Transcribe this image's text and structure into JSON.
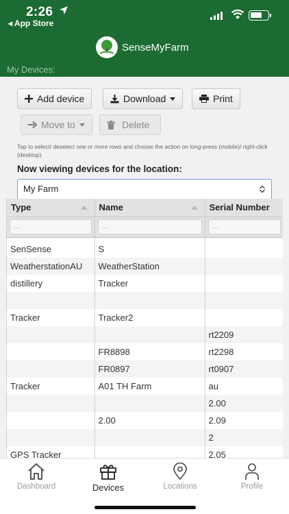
{
  "status_bar": {
    "time": "2:26",
    "back_app": "◂ App Store"
  },
  "app": {
    "logo_text": "SenseMyFarm",
    "section_title": "My Devices:"
  },
  "toolbar": {
    "add_device": "Add device",
    "download": "Download",
    "print": "Print",
    "move_to": "Move to",
    "delete": "Delete"
  },
  "hint_text": "Tap to select/ deselect one or more rows and choose the action on long-press (mobile)/ right-click (desktop)",
  "location": {
    "label": "Now viewing devices for the location:",
    "selected": "My Farm"
  },
  "table": {
    "columns": [
      "Type",
      "Name",
      "Serial Number"
    ],
    "filter_placeholder": "...",
    "rows": [
      [
        "SenSense",
        "S",
        ""
      ],
      [
        "WeatherstationAU",
        "WeatherStation",
        ""
      ],
      [
        "distillery",
        "Tracker",
        ""
      ],
      [
        "",
        "",
        ""
      ],
      [
        "Tracker",
        "Tracker2",
        ""
      ],
      [
        "",
        "",
        "rt2209"
      ],
      [
        "",
        "FR8898",
        "rt2298"
      ],
      [
        "",
        "FR0897",
        "rt0907"
      ],
      [
        "Tracker",
        "A01 TH Farm",
        "au"
      ],
      [
        "",
        "",
        "2.00"
      ],
      [
        "",
        "2.00",
        "2.09"
      ],
      [
        "",
        "",
        "2"
      ],
      [
        "GPS Tracker",
        "",
        "2.05"
      ]
    ]
  },
  "tabs": [
    {
      "label": "Dashboard",
      "icon": "home-icon"
    },
    {
      "label": "Devices",
      "icon": "gift-icon"
    },
    {
      "label": "Locations",
      "icon": "location-pin-icon"
    },
    {
      "label": "Profile",
      "icon": "person-icon"
    }
  ],
  "colors": {
    "brand_green": "#1b6b32",
    "accent_blue": "#6aa0d8"
  }
}
